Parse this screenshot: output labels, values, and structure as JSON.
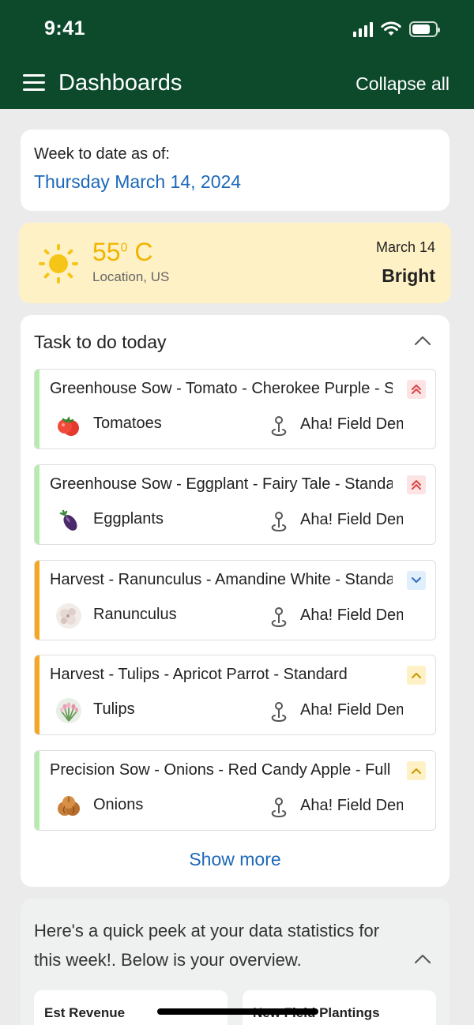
{
  "status_bar": {
    "time": "9:41"
  },
  "header": {
    "title": "Dashboards",
    "collapse_label": "Collapse all"
  },
  "week": {
    "label": "Week to date as of:",
    "date": "Thursday March 14, 2024"
  },
  "weather": {
    "temp_value": "55",
    "temp_degree": "0",
    "temp_unit": " C",
    "location": "Location, US",
    "date": "March 14",
    "condition": "Bright"
  },
  "tasks": {
    "heading": "Task to do today",
    "items": [
      {
        "title": "Greenhouse Sow - Tomato - Cherokee Purple - Standard",
        "crop": "Tomatoes",
        "field": "Aha! Field Demo",
        "status_color": "#b4ecab",
        "priority": "highest",
        "crop_icon": "tomato-icon"
      },
      {
        "title": "Greenhouse Sow - Eggplant - Fairy Tale - Standard",
        "crop": "Eggplants",
        "field": "Aha! Field Demo",
        "status_color": "#b4ecab",
        "priority": "highest",
        "crop_icon": "eggplant-icon"
      },
      {
        "title": "Harvest - Ranunculus - Amandine White - Standard",
        "crop": "Ranunculus",
        "field": "Aha! Field Demo",
        "status_color": "#f5a623",
        "priority": "low",
        "crop_icon": "ranunculus-icon"
      },
      {
        "title": "Harvest - Tulips - Apricot Parrot - Standard",
        "crop": "Tulips",
        "field": "Aha! Field Demo",
        "status_color": "#f5a623",
        "priority": "medium",
        "crop_icon": "tulip-icon"
      },
      {
        "title": "Precision Sow - Onions - Red Candy Apple - Full",
        "crop": "Onions",
        "field": "Aha! Field Demo",
        "status_color": "#b4ecab",
        "priority": "medium",
        "crop_icon": "onion-icon"
      }
    ],
    "show_more": "Show more"
  },
  "stats": {
    "intro": "Here's a quick peek at your data statistics for this week!. Below is your overview.",
    "cards": [
      {
        "label": "Est Revenue"
      },
      {
        "label": "New Field Plantings"
      }
    ]
  },
  "colors": {
    "header_bg": "#0d4a2c",
    "link": "#1d68b8",
    "sun": "#f5c518",
    "weather_bg": "#fff1c6"
  }
}
